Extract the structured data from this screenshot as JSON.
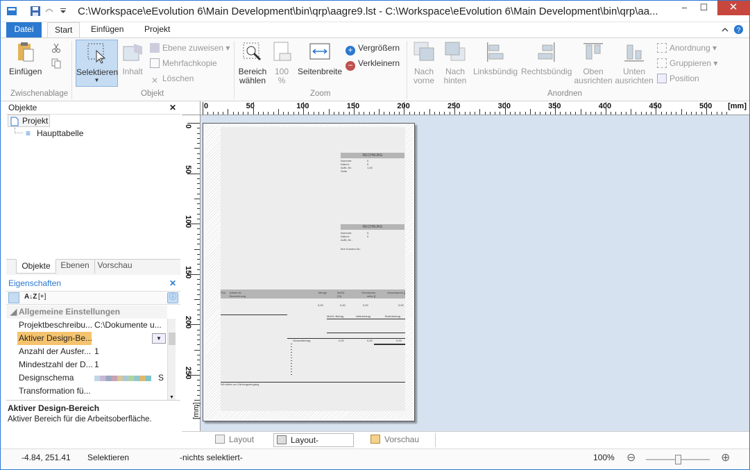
{
  "window": {
    "title": "C:\\Workspace\\eEvolution 6\\Main Development\\bin\\qrp\\aagre9.lst - C:\\Workspace\\eEvolution 6\\Main Development\\bin\\qrp\\aa...",
    "minimize": "–",
    "maximize": "☐",
    "close": "✕"
  },
  "menu": {
    "file": "Datei",
    "tabs": [
      "Start",
      "Einfügen",
      "Projekt"
    ]
  },
  "ribbon": {
    "clipboard": {
      "group": "Zwischenablage",
      "paste": "Einfügen"
    },
    "object": {
      "group": "Objekt",
      "select": "Selektieren",
      "content": "Inhalt",
      "assign_layer": "Ebene zuweisen",
      "multi_copy": "Mehrfachkopie",
      "delete": "Löschen"
    },
    "zoom": {
      "group": "Zoom",
      "select_area_1": "Bereich",
      "select_area_2": "wählen",
      "hundred_1": "100",
      "hundred_2": "%",
      "page_width": "Seitenbreite",
      "zoom_in": "Vergrößern",
      "zoom_out": "Verkleinern"
    },
    "arrange": {
      "group": "Anordnen",
      "front_1": "Nach",
      "front_2": "vorne",
      "back_1": "Nach",
      "back_2": "hinten",
      "left_align": "Linksbündig",
      "right_align": "Rechtsbündig",
      "top_1": "Oben",
      "top_2": "ausrichten",
      "bottom_1": "Unten",
      "bottom_2": "ausrichten",
      "arrangement": "Anordnung",
      "group_btn": "Gruppieren",
      "position": "Position"
    }
  },
  "objects_panel": {
    "title": "Objekte",
    "root": "Projekt",
    "child": "Haupttabelle",
    "tabs": [
      "Objekte",
      "Ebenen",
      "Vorschau"
    ]
  },
  "properties": {
    "title": "Eigenschaften",
    "category": "Allgemeine Einstellungen",
    "rows": [
      {
        "key": "Projektbeschreibu...",
        "value": "C:\\Dokumente u..."
      },
      {
        "key": "Aktiver Design-Be...",
        "value": ""
      },
      {
        "key": "Anzahl der Ausfer...",
        "value": "1"
      },
      {
        "key": "Mindestzahl der D...",
        "value": "1"
      },
      {
        "key": "Designschema",
        "value": "S"
      },
      {
        "key": "Transformation fü...",
        "value": ""
      }
    ],
    "desc_title": "Aktiver Design-Bereich",
    "desc_text": "Aktiver Bereich für die Arbeitsoberfläche.",
    "toolbar_az": "A↓Z",
    "toolbar_plus": "[+]"
  },
  "ruler": {
    "h_ticks": [
      "0",
      "50",
      "100",
      "150",
      "200",
      "250",
      "300",
      "350",
      "400",
      "450",
      "500"
    ],
    "unit": "[mm]",
    "v_ticks": [
      "0",
      "50",
      "100",
      "150",
      "200",
      "250"
    ],
    "v_unit": "[mm]"
  },
  "document": {
    "heading1": "RECHNUNG",
    "heading2": "RECHNUNG",
    "block1": [
      "Nummer:",
      "Datum:",
      "Auftr.-Nr.:",
      "Seite"
    ],
    "block1_vals": [
      "0",
      "",
      "0",
      "1,00"
    ],
    "block2": [
      "Nummer:",
      "Datum:",
      "Auftr.-Nr.:"
    ],
    "block2_vals": [
      "0",
      "",
      "0"
    ],
    "cust": "Ihre Kunden-Nr.:",
    "cols": [
      "Pos",
      "Artikel-Nr. Bezeichnung",
      "Menge",
      "MwSt. [%]",
      "Einzelpreis netto []",
      "Gesamtpreis []"
    ],
    "vals": [
      "0,00",
      "0,00",
      "0,00",
      "0,00"
    ],
    "sums": [
      "MwSt.-Betrag",
      "Nettobetrag",
      "Bruttobetrag"
    ],
    "total": "Gesamtbetrag",
    "total_vals": [
      "0,00",
      "0,00",
      "0,00"
    ],
    "footer": "Wir bitten um Zahlungseingang"
  },
  "bottom_tabs": [
    "Layout",
    "Layout-Vorschau",
    "Vorschau"
  ],
  "status": {
    "coords": "-4.84, 251.41",
    "mode": "Selektieren",
    "selection": "-nichts selektiert-",
    "zoom": "100%",
    "minus": "⊖",
    "plus": "⊕"
  },
  "colors": {
    "accent": "#2b79d0",
    "close": "#c7473e",
    "canvas": "#d6e2ef"
  }
}
